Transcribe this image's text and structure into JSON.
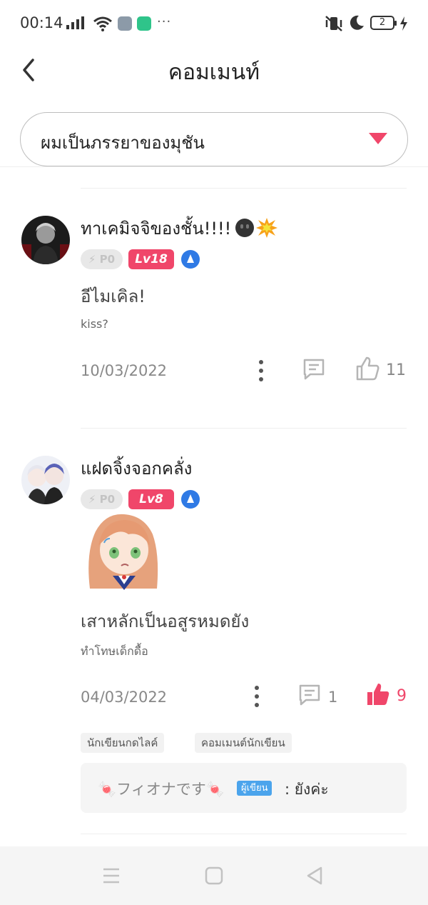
{
  "status_bar": {
    "time": "00:14",
    "battery": "2"
  },
  "header": {
    "title": "คอมเมนท์",
    "back_icon": "chevron-left-icon"
  },
  "filter": {
    "selected": "ผมเป็นภรรยาของมุชัน",
    "caret_color": "#f0466a"
  },
  "colors": {
    "accent": "#f0466a",
    "badge_blue": "#2f7ae5",
    "writer_blue": "#4ba4ec"
  },
  "comments": [
    {
      "username": "ทาเคมิจจิของชั้น!!!!",
      "points_badge": "P0",
      "level": "Lv18",
      "text": "อีไมเคิล!",
      "quote": "kiss?",
      "date": "10/03/2022",
      "reply_count": "",
      "like_count": "11",
      "liked": false
    },
    {
      "username": "แฝดจิ้งจอกคลั่ง",
      "points_badge": "P0",
      "level": "Lv8",
      "sticker": "anime-girl-sticker",
      "text": "เสาหลักเป็นอสูรหมดยัง",
      "quote": "ทำโทษเด็กดื้อ",
      "date": "04/03/2022",
      "reply_count": "1",
      "like_count": "9",
      "liked": true,
      "tags": [
        "นักเขียนกดไลค์",
        "คอมเมนต์นักเขียน"
      ],
      "author_reply": {
        "author": "🍬フィオナです🍬",
        "badge": "ผู้เขียน",
        "text": ": ยังค่ะ"
      }
    }
  ]
}
